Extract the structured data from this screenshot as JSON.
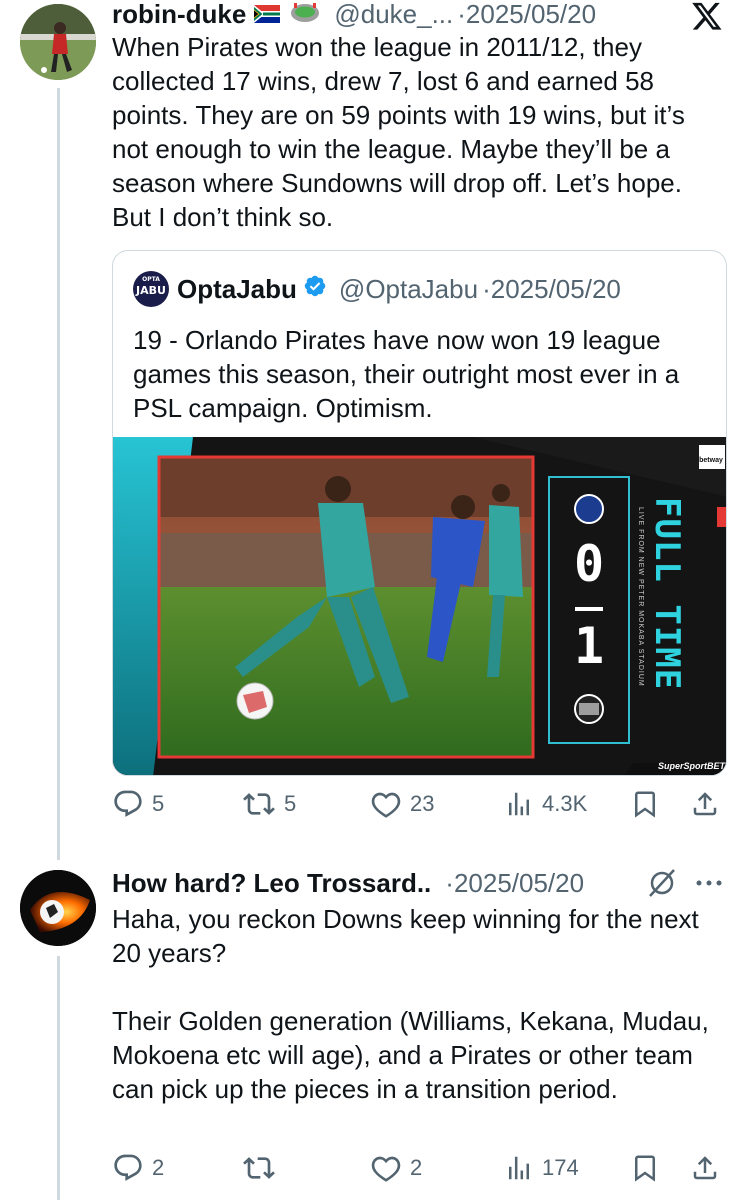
{
  "tweet": {
    "author_name": "robin-duke",
    "author_handle": "@duke_...",
    "separator": "·",
    "date": "2025/05/20",
    "text": "When Pirates won the league in 2011/12, they collected 17 wins, drew 7, lost 6 and earned 58 points. They are on 59 points with 19 wins, but it’s not enough to win the league. Maybe they’ll be a season where Sundowns will drop off. Let’s hope. But I don’t think so.",
    "stats": {
      "replies": "5",
      "reposts": "5",
      "likes": "23",
      "views": "4.3K"
    }
  },
  "quote": {
    "avatar_text_top": "OPTA",
    "avatar_text_bottom": "JABU",
    "author_name": "OptaJabu",
    "author_handle": "@OptaJabu",
    "separator": "·",
    "date": "2025/05/20",
    "text": "19 - Orlando Pirates have now won 19 league games this season, their outright most ever in a PSL campaign. Optimism.",
    "media": {
      "home_score": "0",
      "away_score": "1",
      "status_label": "FULL TIME",
      "venue_caption": "LIVE FROM NEW PETER MOKABA STADIUM",
      "sponsor_top": "betway",
      "sponsor_bottom": "SuperSportBET"
    }
  },
  "reply": {
    "author_name": "How hard? Leo Trossard..",
    "separator": "·",
    "date": "2025/05/20",
    "text": "Haha, you reckon Downs keep winning for the next 20 years?\n\nTheir Golden generation (Williams, Kekana, Mudau, Mokoena etc will age), and a Pirates or other team can pick up the pieces in a transition period.",
    "stats": {
      "replies": "2",
      "reposts": "",
      "likes": "2",
      "views": "174"
    }
  },
  "colors": {
    "text": "#0f1419",
    "muted": "#536471",
    "border": "#cfd9de",
    "verified": "#1d9bf0",
    "media_teal": "#23b3c3"
  }
}
